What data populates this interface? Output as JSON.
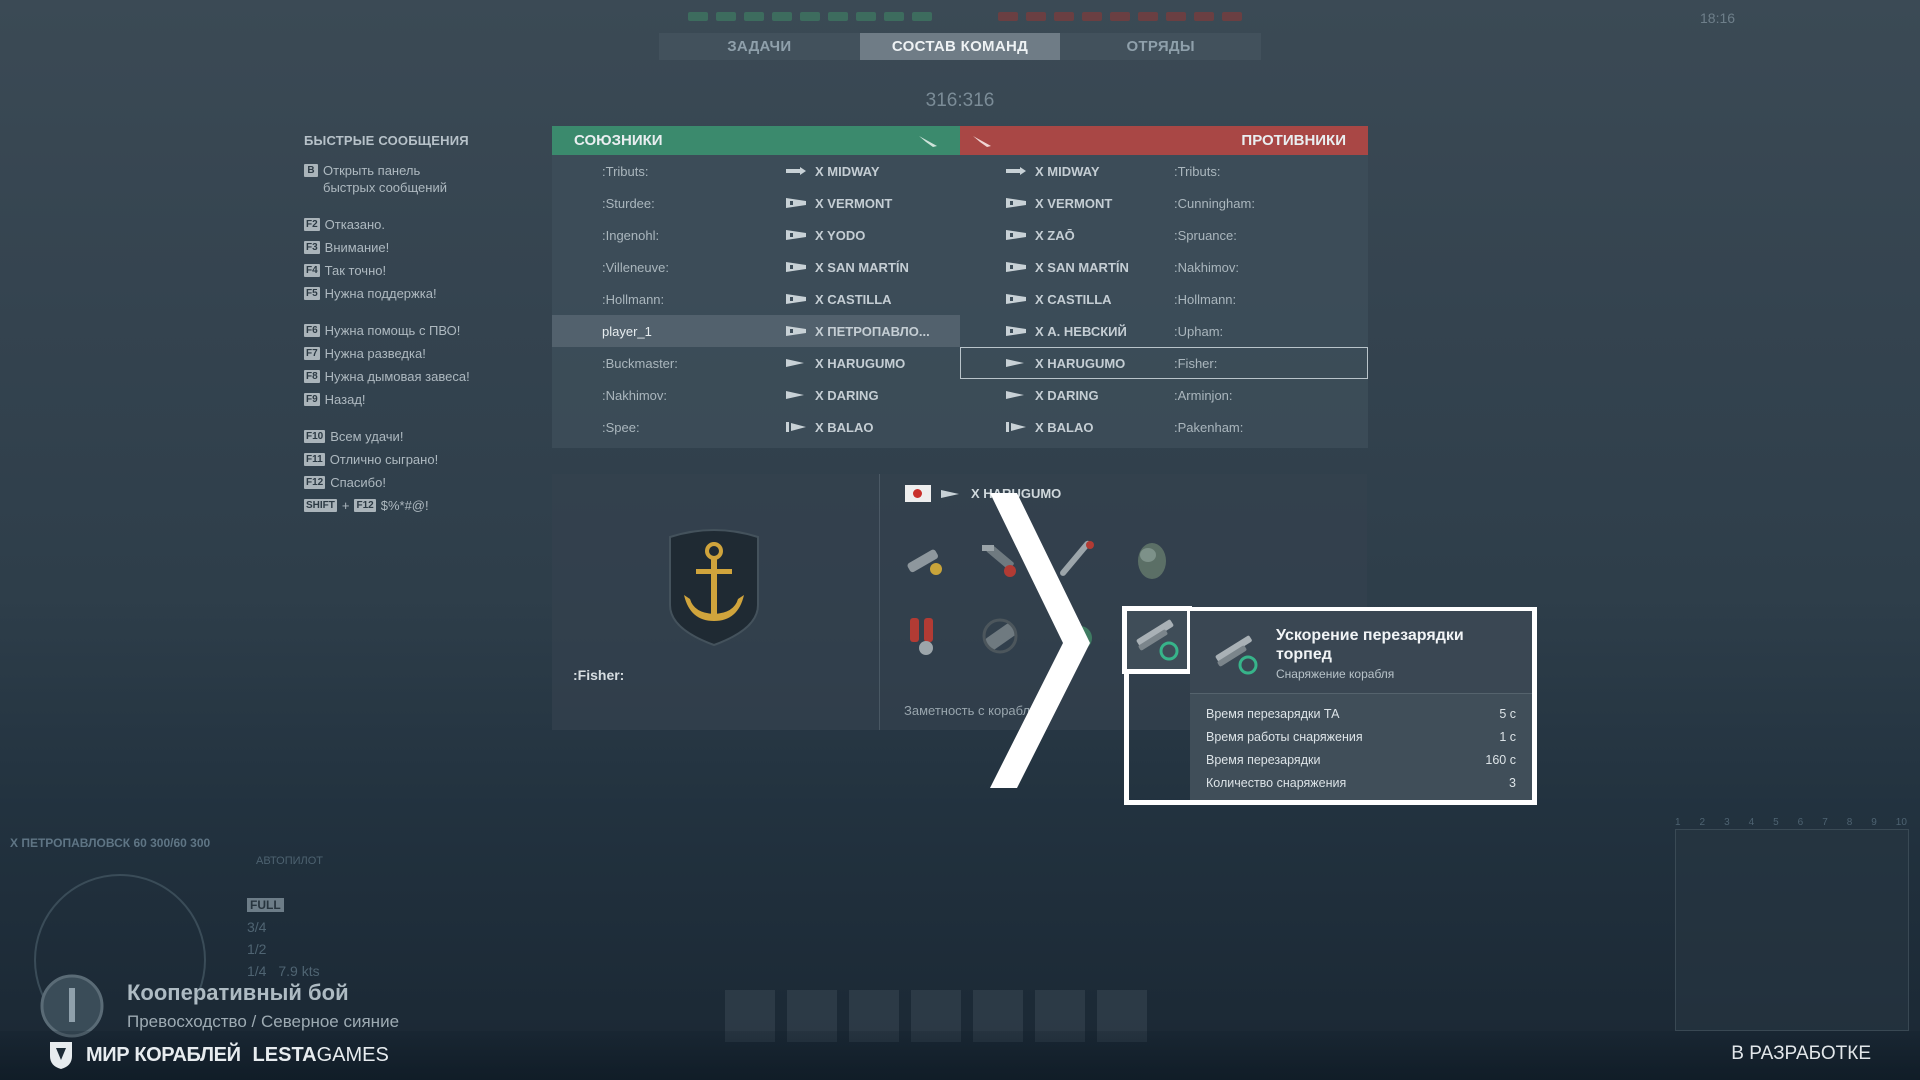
{
  "clock": "18:16",
  "tabs": [
    {
      "label": "ЗАДАЧИ",
      "active": false
    },
    {
      "label": "СОСТАВ КОМАНД",
      "active": true
    },
    {
      "label": "ОТРЯДЫ",
      "active": false
    }
  ],
  "score": "316:316",
  "quick_messages": {
    "title": "БЫСТРЫЕ СООБЩЕНИЯ",
    "open_panel": {
      "key": "B",
      "text": "Открыть панель быстрых сообщений"
    },
    "group1": [
      {
        "key": "F2",
        "text": "Отказано."
      },
      {
        "key": "F3",
        "text": "Внимание!"
      },
      {
        "key": "F4",
        "text": "Так точно!"
      },
      {
        "key": "F5",
        "text": "Нужна поддержка!"
      }
    ],
    "group2": [
      {
        "key": "F6",
        "text": "Нужна помощь с ПВО!"
      },
      {
        "key": "F7",
        "text": "Нужна разведка!"
      },
      {
        "key": "F8",
        "text": "Нужна дымовая завеса!"
      },
      {
        "key": "F9",
        "text": "Назад!"
      }
    ],
    "group3": [
      {
        "key": "F10",
        "text": "Всем удачи!"
      },
      {
        "key": "F11",
        "text": "Отлично сыграно!"
      },
      {
        "key": "F12",
        "text": "Спасибо!"
      }
    ],
    "shift_combo": {
      "key1": "SHIFT",
      "plus": "+",
      "key2": "F12",
      "text": "$%*#@!"
    }
  },
  "allies": {
    "title": "СОЮЗНИКИ",
    "color": "#3b8a6d",
    "rows": [
      {
        "player": ":Tributs:",
        "ship": "X  MIDWAY",
        "class": "carrier"
      },
      {
        "player": ":Sturdee:",
        "ship": "X  VERMONT",
        "class": "battleship"
      },
      {
        "player": ":Ingenohl:",
        "ship": "X  YODO",
        "class": "battleship"
      },
      {
        "player": ":Villeneuve:",
        "ship": "X  SAN MARTÍN",
        "class": "battleship"
      },
      {
        "player": ":Hollmann:",
        "ship": "X  CASTILLA",
        "class": "battleship"
      },
      {
        "player": "player_1",
        "ship": "X  ПЕТРОПАВЛО...",
        "class": "battleship",
        "highlight": true
      },
      {
        "player": ":Buckmaster:",
        "ship": "X  HARUGUMO",
        "class": "destroyer"
      },
      {
        "player": ":Nakhimov:",
        "ship": "X  DARING",
        "class": "destroyer"
      },
      {
        "player": ":Spee:",
        "ship": "X  BALAO",
        "class": "submarine"
      }
    ]
  },
  "enemies": {
    "title": "ПРОТИВНИКИ",
    "color": "#a94745",
    "rows": [
      {
        "player": ":Tributs:",
        "ship": "X  MIDWAY",
        "class": "carrier"
      },
      {
        "player": ":Cunningham:",
        "ship": "X  VERMONT",
        "class": "battleship"
      },
      {
        "player": ":Spruance:",
        "ship": "X  ZAŌ",
        "class": "battleship"
      },
      {
        "player": ":Nakhimov:",
        "ship": "X  SAN MARTÍN",
        "class": "battleship"
      },
      {
        "player": ":Hollmann:",
        "ship": "X  CASTILLA",
        "class": "battleship"
      },
      {
        "player": ":Upham:",
        "ship": "X  А. НЕВСКИЙ",
        "class": "battleship"
      },
      {
        "player": ":Fisher:",
        "ship": "X  HARUGUMO",
        "class": "destroyer",
        "selected": true
      },
      {
        "player": ":Arminjon:",
        "ship": "X  DARING",
        "class": "destroyer"
      },
      {
        "player": ":Pakenham:",
        "ship": "X  BALAO",
        "class": "submarine"
      }
    ]
  },
  "detail": {
    "player": ":Fisher:",
    "ship": "X  HARUGUMO",
    "nation": "japan",
    "visibility_label": "Заметность с корабля",
    "consumables": [
      "damage-control-icon",
      "repair-party-icon",
      "torpedo-icon",
      "smoke-icon",
      "engine-boost-icon",
      "hydro-icon",
      "torpedo-reload-booster-icon"
    ]
  },
  "tooltip": {
    "title": "Ускорение перезарядки торпед",
    "subtitle": "Снаряжение корабля",
    "rows": [
      {
        "label": "Время перезарядки ТА",
        "value": "5 с"
      },
      {
        "label": "Время работы снаряжения",
        "value": "1 с"
      },
      {
        "label": "Время перезарядки",
        "value": "160 с"
      },
      {
        "label": "Количество снаряжения",
        "value": "3"
      }
    ]
  },
  "hud": {
    "own_ship": "X ПЕТРОПАВЛОВСК",
    "hp": "60 300/60 300",
    "autopilot": "АВТОПИЛОТ",
    "speeds": [
      "FULL",
      "3/4",
      "1/2",
      "1/4"
    ],
    "speed_value": "7.9 kts",
    "minimap_numbers": [
      "1",
      "2",
      "3",
      "4",
      "5",
      "6",
      "7",
      "8",
      "9",
      "10"
    ]
  },
  "battle": {
    "title": "Кооперативный бой",
    "subtitle": "Превосходство / Северное сияние"
  },
  "footer": {
    "brand1": "МИР КОРАБЛЕЙ",
    "brand2a": "LESTA",
    "brand2b": "GAMES",
    "status": "В РАЗРАБОТКЕ"
  }
}
